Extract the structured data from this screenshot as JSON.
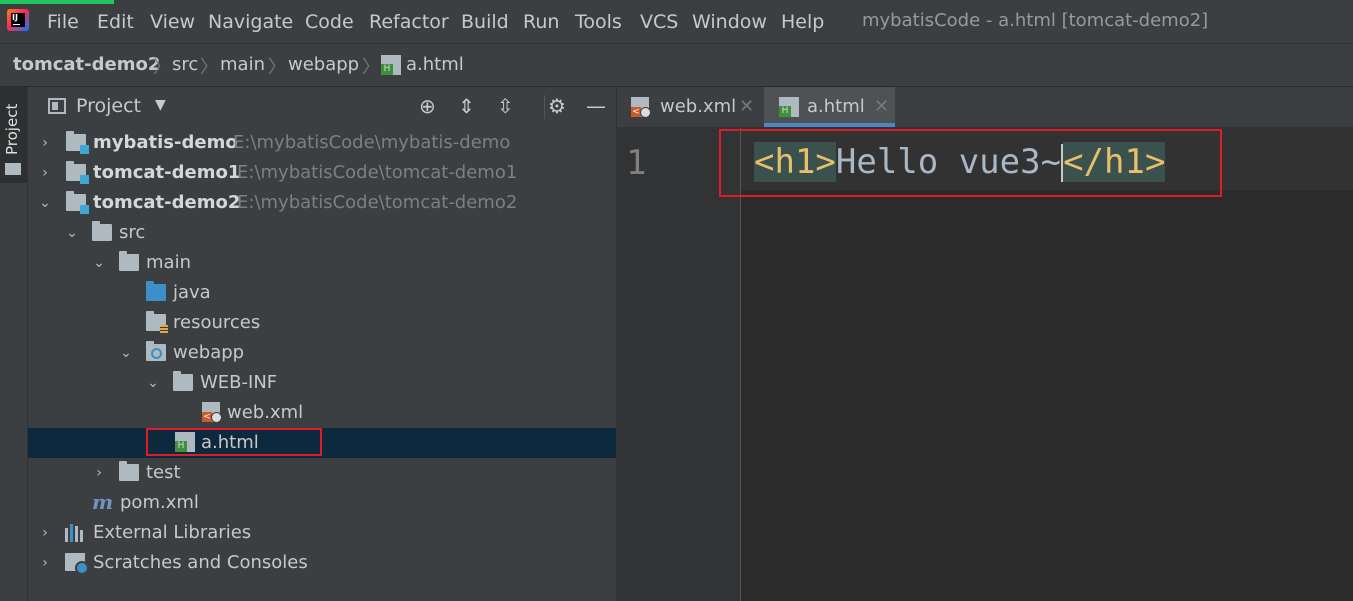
{
  "menubar": {
    "items": [
      "File",
      "Edit",
      "View",
      "Navigate",
      "Code",
      "Refactor",
      "Build",
      "Run",
      "Tools",
      "VCS",
      "Window",
      "Help"
    ],
    "window_title": "mybatisCode - a.html [tomcat-demo2]"
  },
  "breadcrumb": [
    "tomcat-demo2",
    "src",
    "main",
    "webapp",
    "a.html"
  ],
  "stripe": {
    "label": "Project"
  },
  "project_panel": {
    "title": "Project",
    "tree": [
      {
        "label": "mybatis-demo",
        "path": "E:\\mybatisCode\\mybatis-demo"
      },
      {
        "label": "tomcat-demo1",
        "path": "E:\\mybatisCode\\tomcat-demo1"
      },
      {
        "label": "tomcat-demo2",
        "path": "E:\\mybatisCode\\tomcat-demo2"
      },
      {
        "label": "src"
      },
      {
        "label": "main"
      },
      {
        "label": "java"
      },
      {
        "label": "resources"
      },
      {
        "label": "webapp"
      },
      {
        "label": "WEB-INF"
      },
      {
        "label": "web.xml"
      },
      {
        "label": "a.html",
        "selected": true
      },
      {
        "label": "test"
      },
      {
        "label": "pom.xml"
      },
      {
        "label": "External Libraries"
      },
      {
        "label": "Scratches and Consoles"
      }
    ]
  },
  "editor": {
    "tabs": [
      {
        "label": "web.xml",
        "active": false
      },
      {
        "label": "a.html",
        "active": true
      }
    ],
    "line_number": "1",
    "code": {
      "open_tag": "<h1>",
      "text": "Hello vue3~",
      "close_tag": "</h1>"
    }
  },
  "colors": {
    "selection": "#0d293e",
    "highlight_box": "#e01b24",
    "tag": "#e8bf6a",
    "tab_underline": "#4a88c7"
  }
}
